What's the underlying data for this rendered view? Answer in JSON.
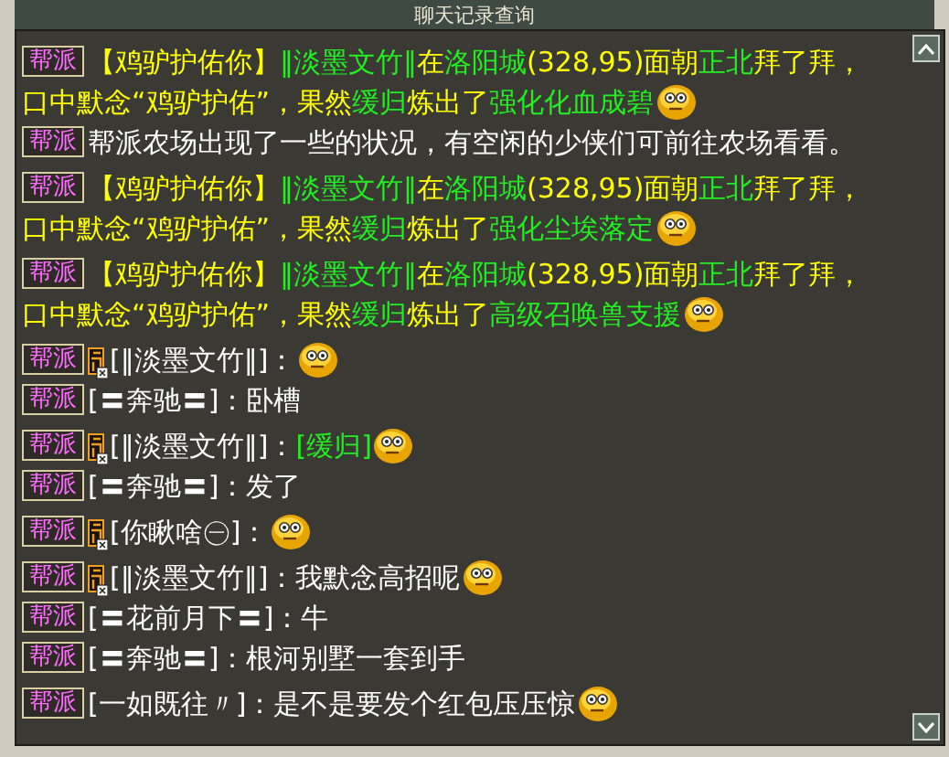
{
  "window": {
    "title": "聊天记录查询"
  },
  "messages": [
    {
      "badge": "帮派",
      "has_icon": false,
      "lines": [
        [
          {
            "kind": "text",
            "text": "【鸡驴护佑你】",
            "color": "#ffff00"
          },
          {
            "kind": "text",
            "text": "‖淡墨文竹‖",
            "color": "#22ee22"
          },
          {
            "kind": "text",
            "text": "在",
            "color": "#ffff00"
          },
          {
            "kind": "text",
            "text": "洛阳城",
            "color": "#22ee22"
          },
          {
            "kind": "text",
            "text": "(328,95)面朝",
            "color": "#ffff00"
          },
          {
            "kind": "text",
            "text": "正北",
            "color": "#22ee22"
          },
          {
            "kind": "text",
            "text": "拜了拜，",
            "color": "#ffff00"
          }
        ],
        [
          {
            "kind": "text",
            "text": "口中默念“鸡驴护佑”，果然",
            "color": "#ffff00"
          },
          {
            "kind": "text",
            "text": "缓归",
            "color": "#22ee22"
          },
          {
            "kind": "text",
            "text": "炼出了",
            "color": "#ffff00"
          },
          {
            "kind": "text",
            "text": "强化化血成碧",
            "color": "#22ee22"
          },
          {
            "kind": "emoji"
          }
        ]
      ]
    },
    {
      "badge": "帮派",
      "has_icon": false,
      "lines": [
        [
          {
            "kind": "text",
            "text": "帮派农场出现了一些的状况，有空闲的少侠们可前往农场看看。",
            "color": "#ffffff"
          }
        ]
      ]
    },
    {
      "badge": "帮派",
      "has_icon": false,
      "lines": [
        [
          {
            "kind": "text",
            "text": "【鸡驴护佑你】",
            "color": "#ffff00"
          },
          {
            "kind": "text",
            "text": "‖淡墨文竹‖",
            "color": "#22ee22"
          },
          {
            "kind": "text",
            "text": "在",
            "color": "#ffff00"
          },
          {
            "kind": "text",
            "text": "洛阳城",
            "color": "#22ee22"
          },
          {
            "kind": "text",
            "text": "(328,95)面朝",
            "color": "#ffff00"
          },
          {
            "kind": "text",
            "text": "正北",
            "color": "#22ee22"
          },
          {
            "kind": "text",
            "text": "拜了拜，",
            "color": "#ffff00"
          }
        ],
        [
          {
            "kind": "text",
            "text": "口中默念“鸡驴护佑”，果然",
            "color": "#ffff00"
          },
          {
            "kind": "text",
            "text": "缓归",
            "color": "#22ee22"
          },
          {
            "kind": "text",
            "text": "炼出了",
            "color": "#ffff00"
          },
          {
            "kind": "text",
            "text": "强化尘埃落定",
            "color": "#22ee22"
          },
          {
            "kind": "emoji"
          }
        ]
      ]
    },
    {
      "badge": "帮派",
      "has_icon": false,
      "lines": [
        [
          {
            "kind": "text",
            "text": "【鸡驴护佑你】",
            "color": "#ffff00"
          },
          {
            "kind": "text",
            "text": "‖淡墨文竹‖",
            "color": "#22ee22"
          },
          {
            "kind": "text",
            "text": "在",
            "color": "#ffff00"
          },
          {
            "kind": "text",
            "text": "洛阳城",
            "color": "#22ee22"
          },
          {
            "kind": "text",
            "text": "(328,95)面朝",
            "color": "#ffff00"
          },
          {
            "kind": "text",
            "text": "正北",
            "color": "#22ee22"
          },
          {
            "kind": "text",
            "text": "拜了拜，",
            "color": "#ffff00"
          }
        ],
        [
          {
            "kind": "text",
            "text": "口中默念“鸡驴护佑”，果然",
            "color": "#ffff00"
          },
          {
            "kind": "text",
            "text": "缓归",
            "color": "#22ee22"
          },
          {
            "kind": "text",
            "text": "炼出了",
            "color": "#ffff00"
          },
          {
            "kind": "text",
            "text": "高级召唤兽支援",
            "color": "#22ee22"
          },
          {
            "kind": "emoji"
          }
        ]
      ]
    },
    {
      "badge": "帮派",
      "has_icon": true,
      "lines": [
        [
          {
            "kind": "text",
            "text": "[‖淡墨文竹‖]：",
            "color": "#ffffff"
          },
          {
            "kind": "emoji"
          }
        ]
      ]
    },
    {
      "badge": "帮派",
      "has_icon": false,
      "lines": [
        [
          {
            "kind": "text",
            "text": "[〓奔驰〓]：卧槽",
            "color": "#ffffff"
          }
        ]
      ]
    },
    {
      "badge": "帮派",
      "has_icon": true,
      "lines": [
        [
          {
            "kind": "text",
            "text": "[‖淡墨文竹‖]：",
            "color": "#ffffff"
          },
          {
            "kind": "text",
            "text": "[缓归]",
            "color": "#22ee22"
          },
          {
            "kind": "emoji"
          }
        ]
      ]
    },
    {
      "badge": "帮派",
      "has_icon": false,
      "lines": [
        [
          {
            "kind": "text",
            "text": "[〓奔驰〓]：发了",
            "color": "#ffffff"
          }
        ]
      ]
    },
    {
      "badge": "帮派",
      "has_icon": true,
      "lines": [
        [
          {
            "kind": "text",
            "text": "[你瞅啥㊀]：",
            "color": "#ffffff"
          },
          {
            "kind": "emoji"
          }
        ]
      ]
    },
    {
      "badge": "帮派",
      "has_icon": true,
      "lines": [
        [
          {
            "kind": "text",
            "text": "[‖淡墨文竹‖]：我默念高招呢",
            "color": "#ffffff"
          },
          {
            "kind": "emoji"
          }
        ]
      ]
    },
    {
      "badge": "帮派",
      "has_icon": false,
      "lines": [
        [
          {
            "kind": "text",
            "text": "[〓花前月下〓]：牛",
            "color": "#ffffff"
          }
        ]
      ]
    },
    {
      "badge": "帮派",
      "has_icon": false,
      "lines": [
        [
          {
            "kind": "text",
            "text": "[〓奔驰〓]：根河别墅一套到手",
            "color": "#ffffff"
          }
        ]
      ]
    },
    {
      "badge": "帮派",
      "has_icon": false,
      "lines": [
        [
          {
            "kind": "text",
            "text": "[一如既往〃]：是不是要发个红包压压惊",
            "color": "#ffffff"
          },
          {
            "kind": "emoji"
          }
        ]
      ]
    }
  ]
}
